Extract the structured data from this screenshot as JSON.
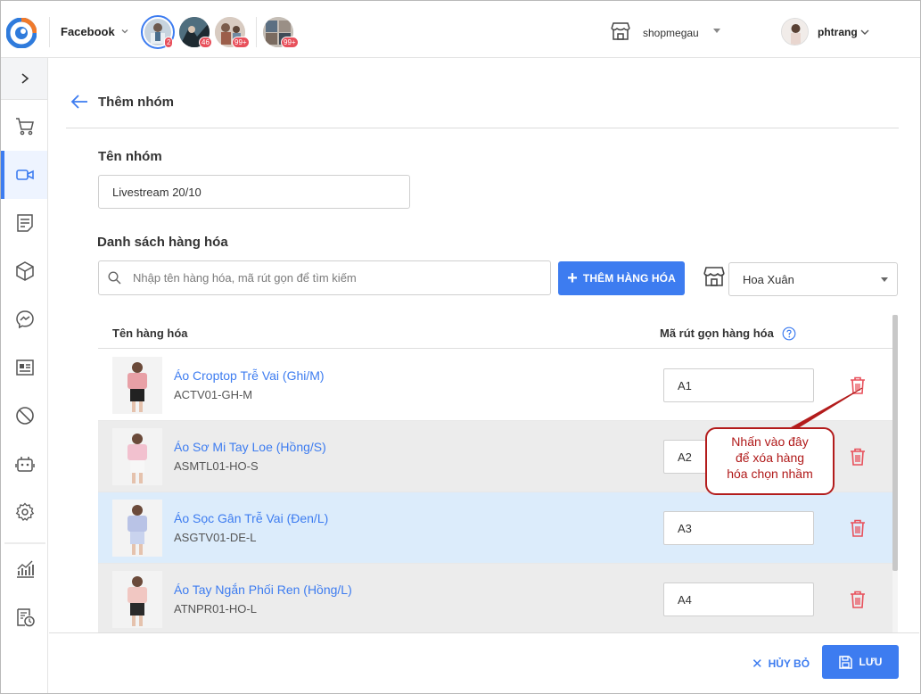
{
  "header": {
    "channel": "Facebook",
    "pages": [
      {
        "badge": "2",
        "selected": true
      },
      {
        "badge": "46",
        "selected": false
      },
      {
        "badge": "99+",
        "selected": false
      },
      {
        "badge": "99+",
        "selected": false
      }
    ],
    "shop": "shopmegau",
    "user": "phtrang"
  },
  "sidebar": {
    "items": [
      "cart-icon",
      "video-icon",
      "notes-icon",
      "box-icon",
      "messenger-icon",
      "id-card-icon",
      "block-icon",
      "bot-icon",
      "settings-icon",
      "chart-icon",
      "report-clock-icon"
    ],
    "active": "video-icon"
  },
  "page": {
    "title": "Thêm nhóm",
    "group_name_label": "Tên nhóm",
    "group_name_value": "Livestream 20/10",
    "products_label": "Danh sách hàng hóa",
    "search_placeholder": "Nhập tên hàng hóa, mã rút gọn để tìm kiếm",
    "add_button": "THÊM HÀNG HÓA",
    "store_select": "Hoa Xuân"
  },
  "table": {
    "columns": {
      "name": "Tên hàng hóa",
      "code": "Mã rút gọn hàng hóa"
    },
    "rows": [
      {
        "name": "Áo Croptop Trễ Vai (Ghi/M)",
        "sku": "ACTV01-GH-M",
        "code": "A1",
        "top": "#e8a0a6",
        "bottom": "#222222"
      },
      {
        "name": "Áo Sơ Mi Tay Loe (Hồng/S)",
        "sku": "ASMTL01-HO-S",
        "code": "A2",
        "top": "#f2c1cf",
        "bottom": "#f7f7f7"
      },
      {
        "name": "Áo Sọc Gân Trễ Vai (Đen/L)",
        "sku": "ASGTV01-DE-L",
        "code": "A3",
        "top": "#b9c3e6",
        "bottom": "#c9d3ee"
      },
      {
        "name": "Áo Tay Ngắn Phối Ren (Hồng/L)",
        "sku": "ATNPR01-HO-L",
        "code": "A4",
        "top": "#f1c7c2",
        "bottom": "#2a2a2a"
      }
    ]
  },
  "callout": {
    "line1": "Nhấn vào đây",
    "line2": "để xóa hàng",
    "line3": "hóa chọn nhầm"
  },
  "footer": {
    "cancel": "HỦY BỎ",
    "save": "LƯU"
  },
  "colors": {
    "accent": "#3d7cf0",
    "danger": "#e8505b",
    "callout": "#b31c1c"
  }
}
